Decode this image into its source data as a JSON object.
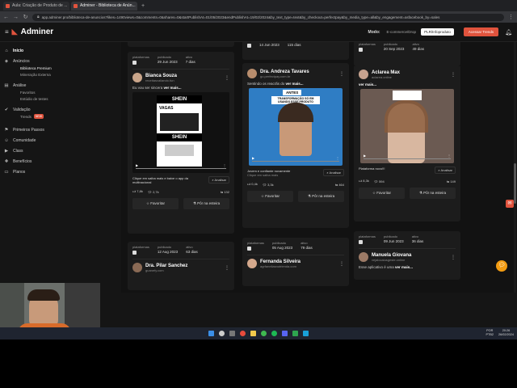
{
  "browser": {
    "tabs": [
      {
        "label": "Aula: Criação de Produto de ...",
        "active": false
      },
      {
        "label": "Adminer - Biblioteca de Anún...",
        "active": true
      }
    ],
    "url": "app.adminer.pro/biblioteca-de-anuncios?likes=1490views=0&comments=0&shares=0&startPublishAt=01/05/2023&endPublishAt=19/02/2024&by_text_type=text&by_checkout=perfectpay&by_media_type=all&by_engagement=asfacebook_by=sales"
  },
  "header": {
    "logo": "Adminer",
    "mode_label": "Modo:",
    "mode_options": [
      "E-commerce/Drop",
      "PLR/Infoproduto"
    ],
    "trend_button": "Acessar Trends"
  },
  "sidebar": {
    "items": [
      {
        "label": "Início",
        "icon": "home-icon",
        "active": true
      },
      {
        "label": "Anúncios",
        "icon": "megaphone-icon",
        "active": false,
        "children": [
          {
            "label": "Biblioteca Premium",
            "active": true
          },
          {
            "label": "Mineração Externa",
            "active": false
          }
        ]
      },
      {
        "label": "Análise",
        "icon": "chart-icon",
        "active": false,
        "children": [
          {
            "label": "Favoritos",
            "active": false
          },
          {
            "label": "Estúdio de testes",
            "active": false
          }
        ]
      },
      {
        "label": "Validação",
        "icon": "check-icon",
        "active": false,
        "children": [
          {
            "label": "Trends",
            "active": false,
            "badge": "NEW"
          }
        ]
      },
      {
        "label": "Primeiros Passos",
        "icon": "flag-icon",
        "active": false
      },
      {
        "label": "Comunidade",
        "icon": "people-icon",
        "active": false
      },
      {
        "label": "Class",
        "icon": "play-icon",
        "active": false
      },
      {
        "label": "Benefícios",
        "icon": "gift-icon",
        "active": false
      },
      {
        "label": "Planos",
        "icon": "card-icon",
        "active": false
      }
    ]
  },
  "labels": {
    "platforms": "plataformas",
    "published": "publicado",
    "active": "ativo",
    "favorite": "Favoritar",
    "studio": "Pôr na esteira",
    "analyze": "Analisar"
  },
  "top_cards": [
    {
      "published": "14 Jun 2023",
      "active": "115 dias"
    },
    {
      "published": "20 Sep 2023",
      "active": "49 dias"
    }
  ],
  "cards": [
    {
      "published": "29 Jun 2023",
      "active": "7 dias",
      "name": "Bianca Souza",
      "site": "receitasvaliando.fun",
      "desc": "Eu vou ser sincera ",
      "more": "ver mais...",
      "video_text": [
        "SHEIN",
        "VAGAS",
        "SHEIN"
      ],
      "caption": "Clique em saiba mais e baixe o app da multinacional",
      "caption_sub": "",
      "likes": "7,8k",
      "comments": "2,7k",
      "shares": "132"
    },
    {
      "published": "",
      "active": "",
      "name": "Dra. Andreza Tavares",
      "site": "go.perfectpay.com.br",
      "desc": "Sentindo os reacrãs do ",
      "more": "ver mais...",
      "video_text": [
        "ANTES",
        "TRANSFORMAÇÃO SÓ EM USANDO ESSE PRODUTO"
      ],
      "caption": "Jovem e confiante novamente",
      "caption_sub": "Clique em saiba mais",
      "likes": "0,4k",
      "comments": "3,3k",
      "shares": "464"
    },
    {
      "published": "",
      "active": "",
      "name": "Aclarea Max",
      "site": "aclarea.online",
      "desc": "",
      "more": "ver mais...",
      "video_text": [],
      "caption": "Plataforma novo!!!",
      "caption_sub": "",
      "likes": "8,3k",
      "comments": "594",
      "shares": "149"
    }
  ],
  "bottom_cards": [
    {
      "published": "12 Aug 2023",
      "active": "63 dias",
      "name": "Dra. Pilar Sanchez",
      "site": "guanefy.com"
    },
    {
      "published": "05 Aug 2023",
      "active": "79 dias",
      "name": "Fernanda Silveira",
      "site": "agrfaneliasnutrienda.com"
    },
    {
      "published": "09 Jun 2023",
      "active": "36 dias",
      "name": "Manuela Giovana",
      "site": "vejalocaiusgeste.online",
      "desc": "Esse aplicativo é uma ",
      "more": "ver mais..."
    }
  ],
  "tray": {
    "lang": "POR",
    "layout": "PTB2",
    "time": "20:26",
    "date": "26/02/2024"
  }
}
